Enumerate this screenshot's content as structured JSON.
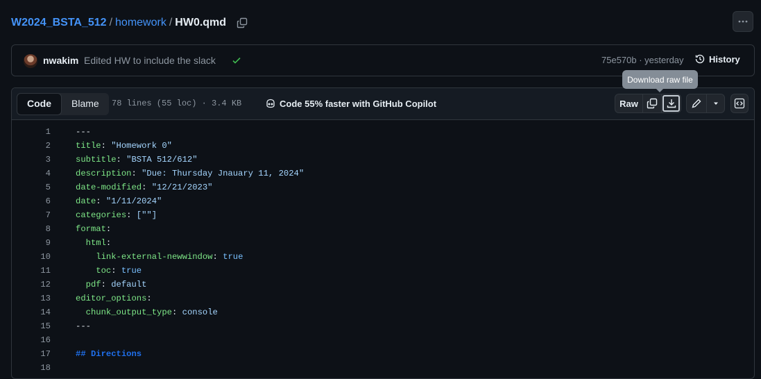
{
  "breadcrumb": {
    "repo": "W2024_BSTA_512",
    "sep": "/",
    "folder": "homework",
    "file": "HW0.qmd"
  },
  "commit": {
    "author": "nwakim",
    "message": "Edited HW to include the slack",
    "sha_time": "75e570b · yesterday",
    "history_label": "History"
  },
  "file_header": {
    "tabs": [
      "Code",
      "Blame"
    ],
    "meta": "78 lines (55 loc) · 3.4 KB",
    "copilot": "Code 55% faster with GitHub Copilot",
    "raw_label": "Raw",
    "tooltip": "Download raw file"
  },
  "code_lines": [
    {
      "n": "1",
      "parts": [
        [
          "---",
          ""
        ]
      ]
    },
    {
      "n": "2",
      "parts": [
        [
          "title",
          "k"
        ],
        [
          ": ",
          ""
        ],
        [
          "\"Homework 0\"",
          "s"
        ]
      ]
    },
    {
      "n": "3",
      "parts": [
        [
          "subtitle",
          "k"
        ],
        [
          ": ",
          ""
        ],
        [
          "\"BSTA 512/612\"",
          "s"
        ]
      ]
    },
    {
      "n": "4",
      "parts": [
        [
          "description",
          "k"
        ],
        [
          ": ",
          ""
        ],
        [
          "\"Due: Thursday Jnauary 11, 2024\"",
          "s"
        ]
      ]
    },
    {
      "n": "5",
      "parts": [
        [
          "date-modified",
          "k"
        ],
        [
          ": ",
          ""
        ],
        [
          "\"12/21/2023\"",
          "s"
        ]
      ]
    },
    {
      "n": "6",
      "parts": [
        [
          "date",
          "k"
        ],
        [
          ": ",
          ""
        ],
        [
          "\"1/11/2024\"",
          "s"
        ]
      ]
    },
    {
      "n": "7",
      "parts": [
        [
          "categories",
          "k"
        ],
        [
          ": ",
          ""
        ],
        [
          "[\"\"]",
          "s"
        ]
      ]
    },
    {
      "n": "8",
      "parts": [
        [
          "format",
          "k"
        ],
        [
          ":",
          ""
        ]
      ]
    },
    {
      "n": "9",
      "parts": [
        [
          "  ",
          ""
        ],
        [
          "html",
          "k"
        ],
        [
          ":",
          ""
        ]
      ]
    },
    {
      "n": "10",
      "parts": [
        [
          "    ",
          ""
        ],
        [
          "link-external-newwindow",
          "k"
        ],
        [
          ": ",
          ""
        ],
        [
          "true",
          "b"
        ]
      ]
    },
    {
      "n": "11",
      "parts": [
        [
          "    ",
          ""
        ],
        [
          "toc",
          "k"
        ],
        [
          ": ",
          ""
        ],
        [
          "true",
          "b"
        ]
      ]
    },
    {
      "n": "12",
      "parts": [
        [
          "  ",
          ""
        ],
        [
          "pdf",
          "k"
        ],
        [
          ": ",
          ""
        ],
        [
          "default",
          "s"
        ]
      ]
    },
    {
      "n": "13",
      "parts": [
        [
          "editor_options",
          "k"
        ],
        [
          ":",
          ""
        ]
      ]
    },
    {
      "n": "14",
      "parts": [
        [
          "  ",
          ""
        ],
        [
          "chunk_output_type",
          "k"
        ],
        [
          ": ",
          ""
        ],
        [
          "console",
          "s"
        ]
      ]
    },
    {
      "n": "15",
      "parts": [
        [
          "---",
          ""
        ]
      ]
    },
    {
      "n": "16",
      "parts": []
    },
    {
      "n": "17",
      "parts": [
        [
          "## Directions",
          "h"
        ]
      ]
    },
    {
      "n": "18",
      "parts": []
    }
  ]
}
